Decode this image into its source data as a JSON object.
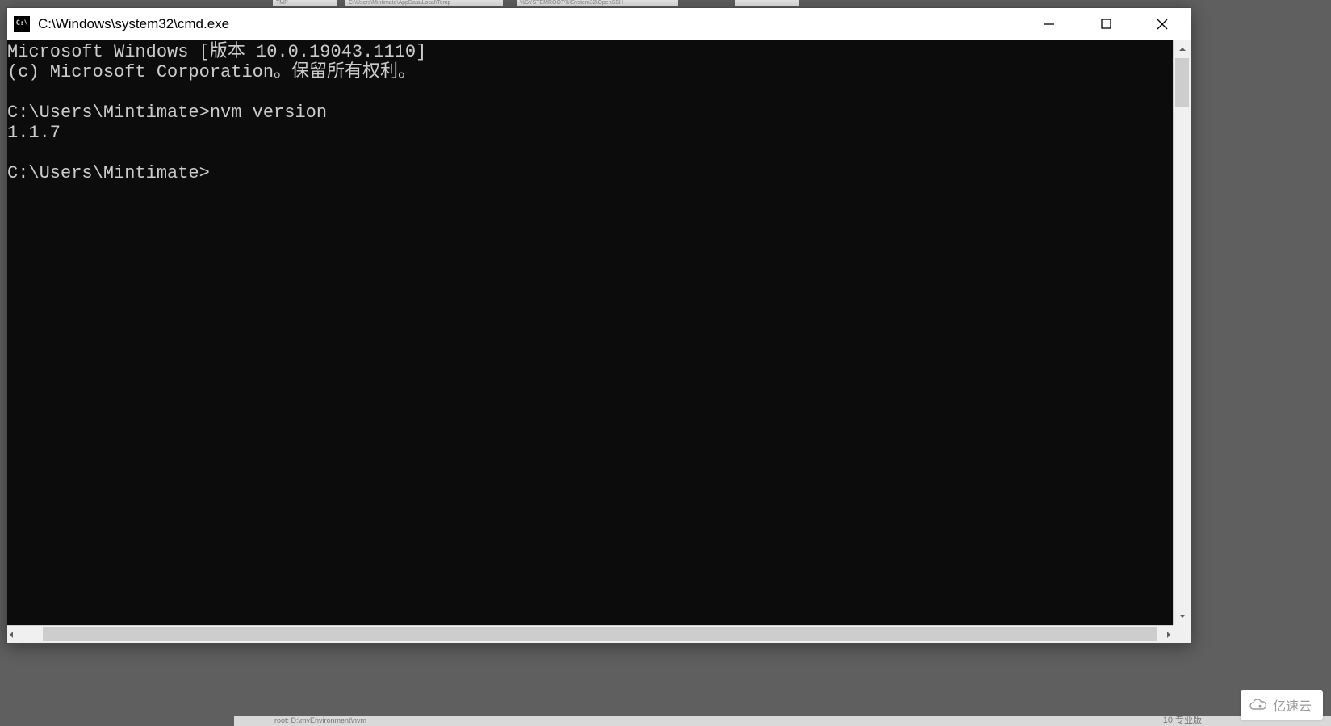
{
  "background": {
    "tabs": [
      "TMP",
      "C:\\Users\\Mintimate\\AppData\\Local\\Temp",
      "%SYSTEMROOT%\\System32\\OpenSSH",
      ""
    ],
    "bottom_left": "root: D:\\myEnvironment\\nvm",
    "bottom_right": "10 专业版"
  },
  "watermark": {
    "label": "亿速云"
  },
  "window": {
    "title": "C:\\Windows\\system32\\cmd.exe",
    "icon_label": "C:\\"
  },
  "terminal": {
    "lines": [
      "Microsoft Windows [版本 10.0.19043.1110]",
      "(c) Microsoft Corporation。保留所有权利。",
      "",
      "C:\\Users\\Mintimate>nvm version",
      "1.1.7",
      "",
      "C:\\Users\\Mintimate>"
    ]
  }
}
